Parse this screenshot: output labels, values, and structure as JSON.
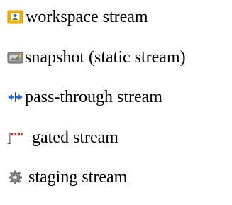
{
  "legend": {
    "items": [
      {
        "label": "workspace stream",
        "icon": "workspace-stream-icon"
      },
      {
        "label": "snapshot (static stream)",
        "icon": "snapshot-stream-icon"
      },
      {
        "label": "pass-through stream",
        "icon": "pass-through-stream-icon"
      },
      {
        "label": "gated stream",
        "icon": "gated-stream-icon"
      },
      {
        "label": "staging stream",
        "icon": "staging-stream-icon"
      }
    ]
  },
  "colors": {
    "workspace_icon_fill": "#f2b705",
    "workspace_icon_inner": "#ffffff",
    "snapshot_icon_body": "#9a9a9a",
    "snapshot_icon_accent": "#f5d240",
    "pass_through_arrows": "#2f6fd6",
    "gated_stripe": "#c62828",
    "staging_gear": "#7a7a7a"
  }
}
